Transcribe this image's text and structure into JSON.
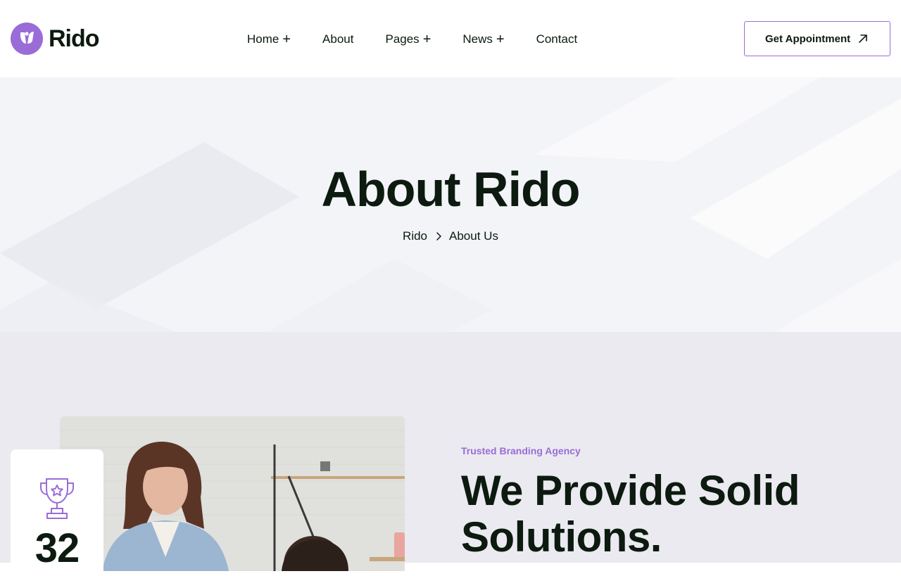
{
  "header": {
    "brand": "Rido",
    "nav": [
      {
        "label": "Home",
        "has_submenu": true
      },
      {
        "label": "About",
        "has_submenu": false
      },
      {
        "label": "Pages",
        "has_submenu": true
      },
      {
        "label": "News",
        "has_submenu": true
      },
      {
        "label": "Contact",
        "has_submenu": false
      }
    ],
    "submenu_symbol": "+",
    "cta_label": "Get Appointment"
  },
  "hero": {
    "title": "About Rido",
    "breadcrumb": [
      "Rido",
      "About Us"
    ]
  },
  "about": {
    "award_number": "32",
    "tagline": "Trusted Branding Agency",
    "title": "We Provide Solid Solutions."
  },
  "colors": {
    "accent": "#9a6cd8",
    "text_dark": "#0c1a0f",
    "hero_bg": "#f3f4f8",
    "section_bg": "#ebeaf0"
  },
  "icons": {
    "logo": "logo-mark-icon",
    "cta_arrow": "arrow-up-right-icon",
    "breadcrumb_separator": "chevron-right-icon",
    "award": "trophy-icon"
  }
}
